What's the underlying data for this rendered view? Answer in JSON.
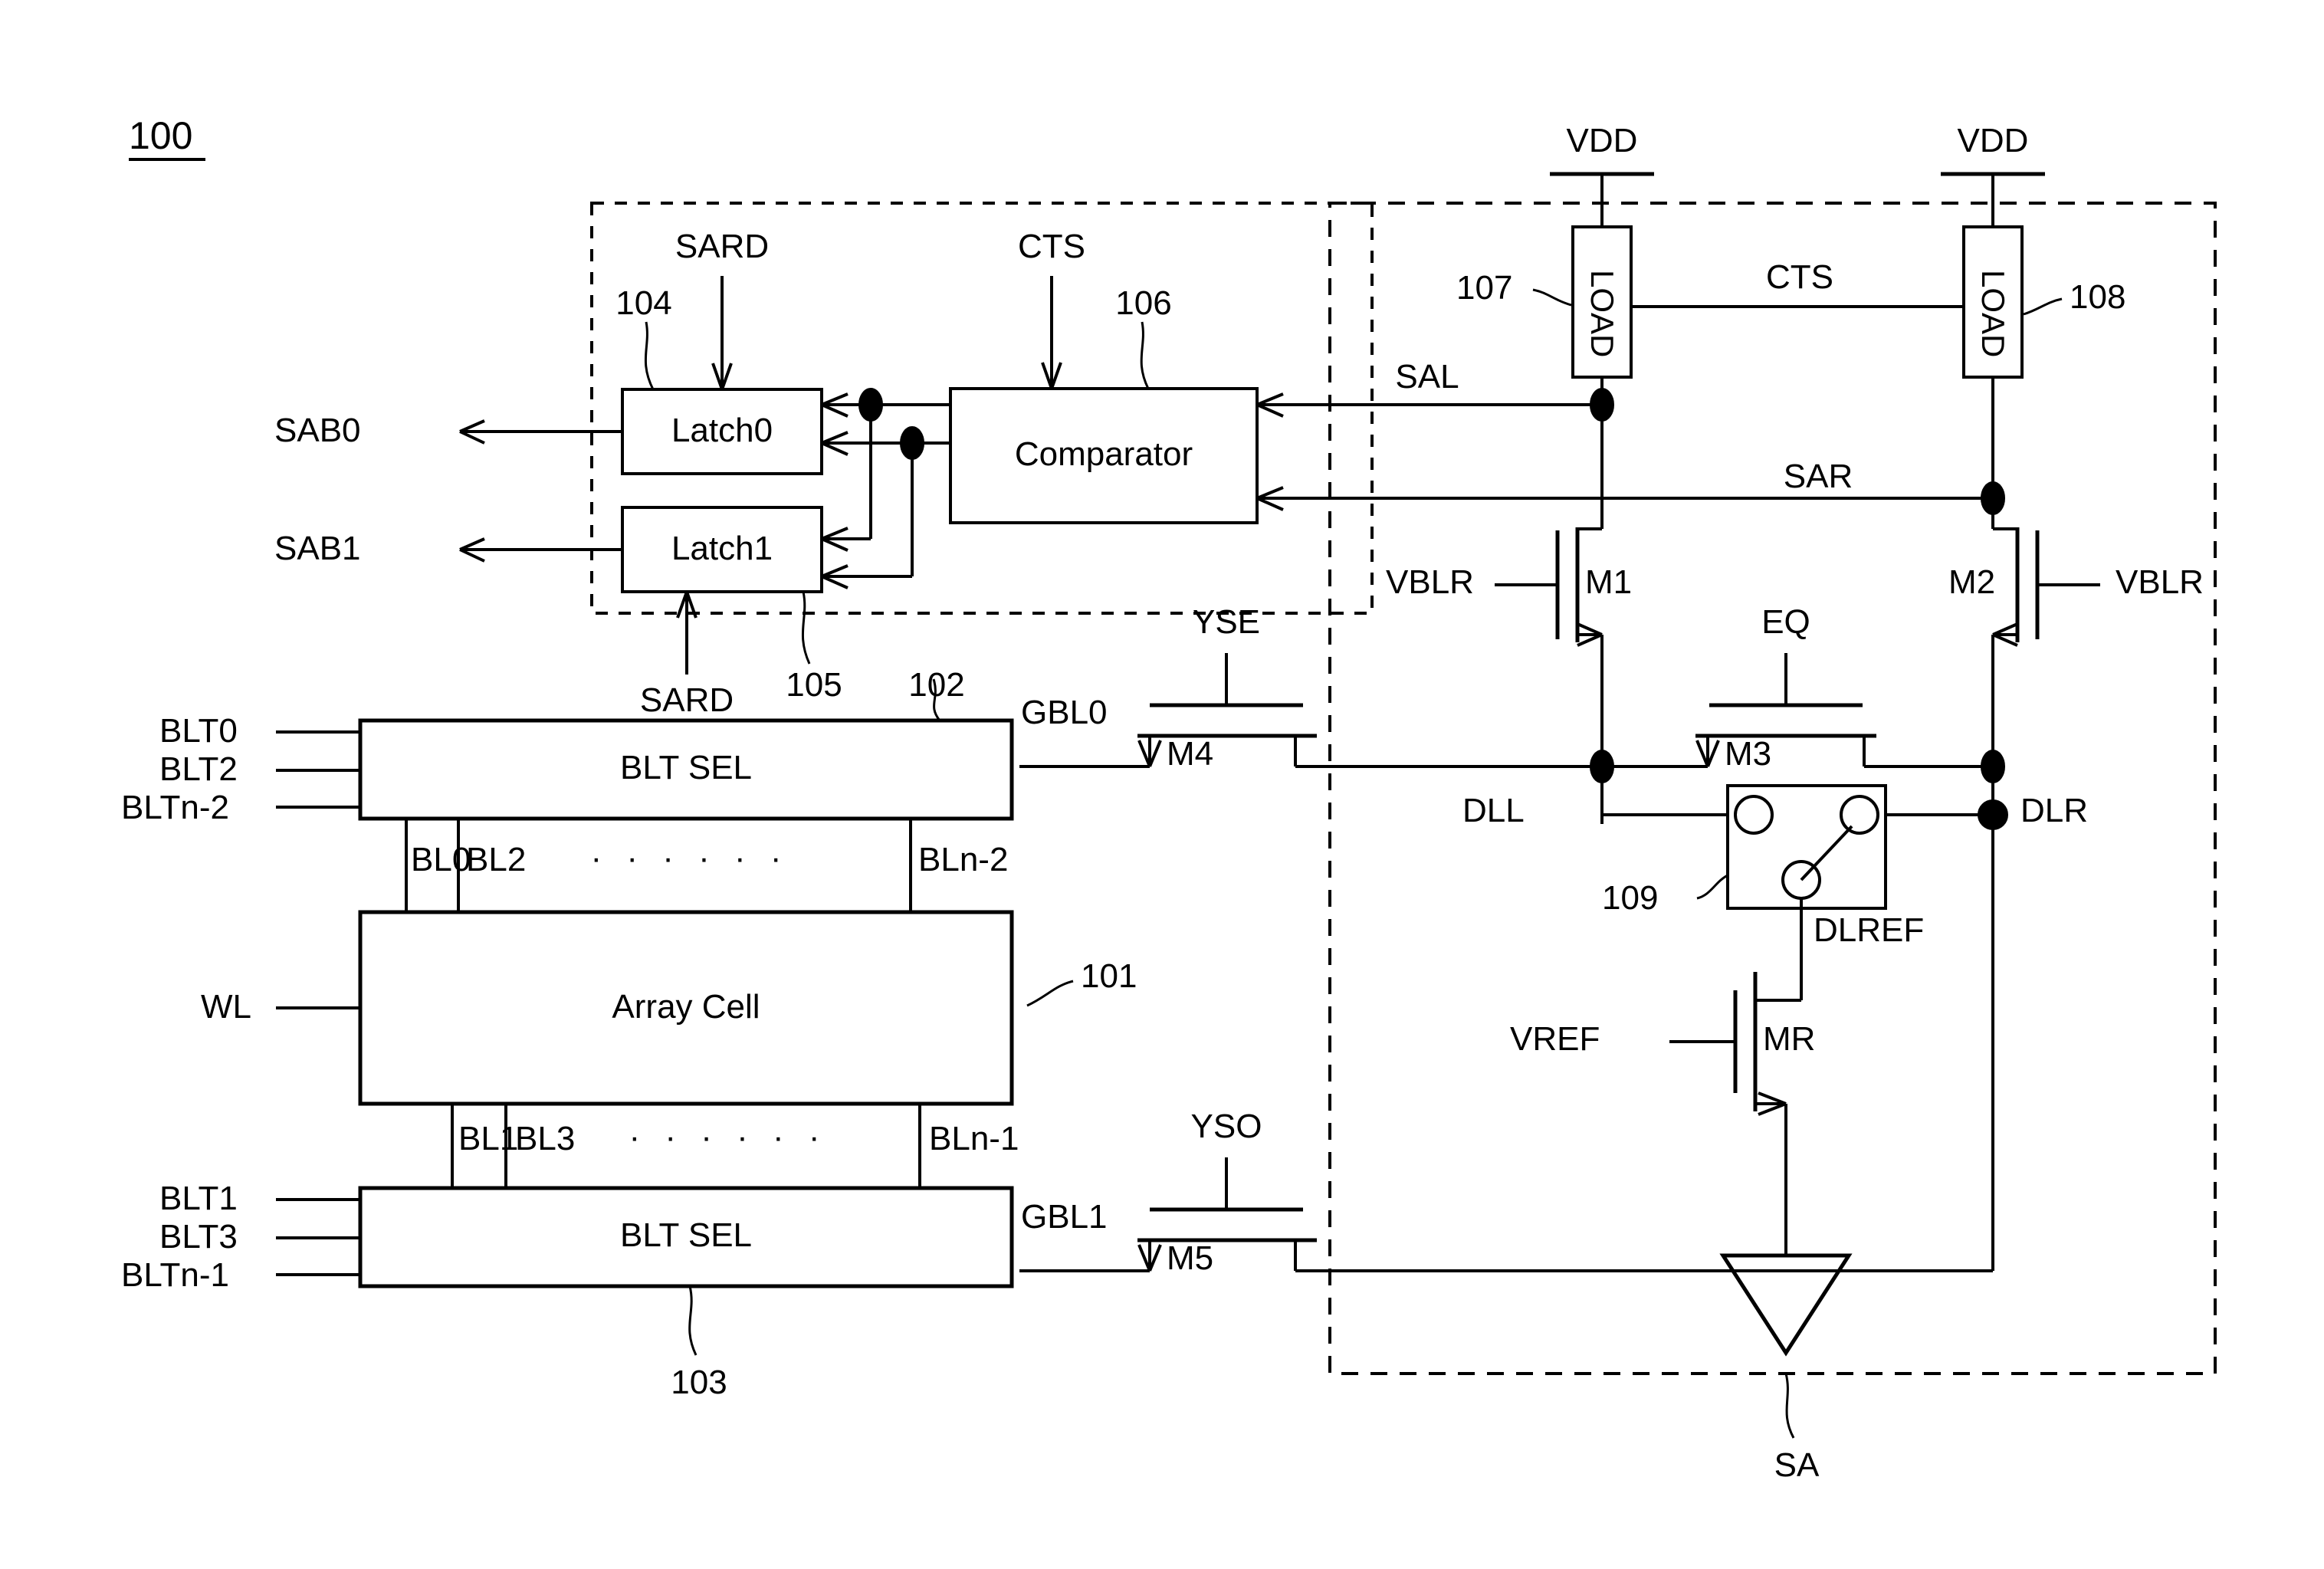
{
  "figure": {
    "number": "100",
    "sense_amp_label": "SA"
  },
  "blocks": {
    "latch0": {
      "label": "Latch0",
      "ref": "104"
    },
    "latch1": {
      "label": "Latch1",
      "ref": "105"
    },
    "comparator": {
      "label": "Comparator",
      "ref": "106"
    },
    "load_left": {
      "label": "LOAD",
      "ref": "107"
    },
    "load_right": {
      "label": "LOAD",
      "ref": "108"
    },
    "blt_sel_top": {
      "label": "BLT SEL",
      "ref": "102"
    },
    "blt_sel_bottom": {
      "label": "BLT SEL",
      "ref": "103"
    },
    "array_cell": {
      "label": "Array Cell",
      "ref": "101"
    },
    "switch": {
      "ref": "109"
    }
  },
  "signals": {
    "sard_top": "SARD",
    "sard_bottom": "SARD",
    "cts_top": "CTS",
    "cts_mid": "CTS",
    "sab0": "SAB0",
    "sab1": "SAB1",
    "sal": "SAL",
    "sar": "SAR",
    "vdd_left": "VDD",
    "vdd_right": "VDD",
    "vblr_left": "VBLR",
    "vblr_right": "VBLR",
    "eq": "EQ",
    "dll": "DLL",
    "dlr": "DLR",
    "dlref": "DLREF",
    "vref": "VREF",
    "yse": "YSE",
    "yso": "YSO",
    "gbl0": "GBL0",
    "gbl1": "GBL1",
    "wl": "WL"
  },
  "transistors": {
    "m1": "M1",
    "m2": "M2",
    "m3": "M3",
    "m4": "M4",
    "m5": "M5",
    "mr": "MR"
  },
  "bitline_inputs_top": [
    "BLT0",
    "BLT2",
    "BLTn-2"
  ],
  "bitline_inputs_bottom": [
    "BLT1",
    "BLT3",
    "BLTn-1"
  ],
  "bitlines_top": {
    "first": "BL0",
    "second": "BL2",
    "dots": "· · · · · ·",
    "last": "BLn-2"
  },
  "bitlines_bottom": {
    "first": "BL1",
    "second": "BL3",
    "dots": "· · · · · ·",
    "last": "BLn-1"
  },
  "colors": {
    "line": "#000000",
    "background": "#ffffff"
  }
}
